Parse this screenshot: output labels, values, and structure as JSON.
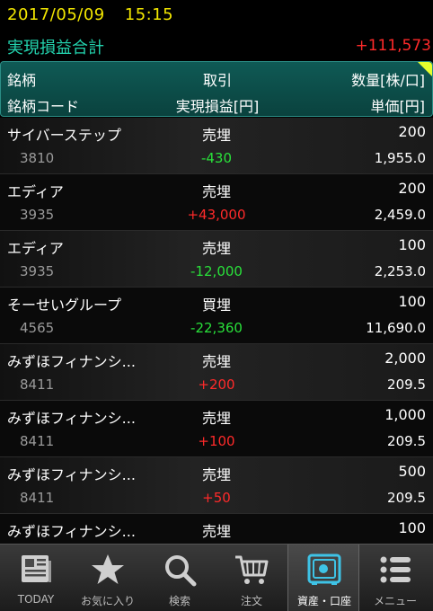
{
  "status": {
    "date": "2017/05/09",
    "time": "15:15"
  },
  "summary": {
    "label": "実現損益合計",
    "value": "+111,573"
  },
  "header": {
    "row1": {
      "c1": "銘柄",
      "c2": "取引",
      "c3": "数量[株/口]"
    },
    "row2": {
      "c1": "銘柄コード",
      "c2": "実現損益[円]",
      "c3": "単価[円]"
    }
  },
  "rows": [
    {
      "name": "サイバーステップ",
      "trade": "売埋",
      "qty": "200",
      "code": "3810",
      "pl": "-430",
      "price": "1,955.0"
    },
    {
      "name": "エディア",
      "trade": "売埋",
      "qty": "200",
      "code": "3935",
      "pl": "+43,000",
      "price": "2,459.0"
    },
    {
      "name": "エディア",
      "trade": "売埋",
      "qty": "100",
      "code": "3935",
      "pl": "-12,000",
      "price": "2,253.0"
    },
    {
      "name": "そーせいグループ",
      "trade": "買埋",
      "qty": "100",
      "code": "4565",
      "pl": "-22,360",
      "price": "11,690.0"
    },
    {
      "name": "みずほフィナンシ...",
      "trade": "売埋",
      "qty": "2,000",
      "code": "8411",
      "pl": "+200",
      "price": "209.5"
    },
    {
      "name": "みずほフィナンシ...",
      "trade": "売埋",
      "qty": "1,000",
      "code": "8411",
      "pl": "+100",
      "price": "209.5"
    },
    {
      "name": "みずほフィナンシ...",
      "trade": "売埋",
      "qty": "500",
      "code": "8411",
      "pl": "+50",
      "price": "209.5"
    },
    {
      "name": "みずほフィナンシ...",
      "trade": "売埋",
      "qty": "100",
      "code": "",
      "pl": "",
      "price": ""
    }
  ],
  "tabs": [
    {
      "label": "TODAY",
      "icon": "newspaper-icon"
    },
    {
      "label": "お気に入り",
      "icon": "star-icon"
    },
    {
      "label": "検索",
      "icon": "search-icon"
    },
    {
      "label": "注文",
      "icon": "cart-icon"
    },
    {
      "label": "資産・口座",
      "icon": "safe-icon",
      "active": true
    },
    {
      "label": "メニュー",
      "icon": "menu-icon"
    }
  ],
  "colors": {
    "date": "#f2e600",
    "summary_label": "#23d3ae",
    "positive": "#ff2a2a",
    "negative": "#29e03a",
    "header_bg": "#0f5a55"
  }
}
